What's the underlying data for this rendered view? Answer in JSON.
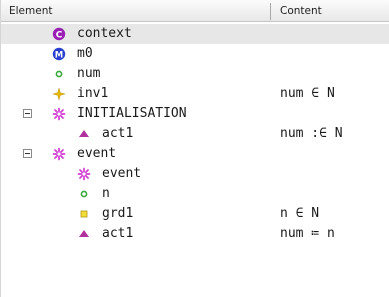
{
  "header": {
    "element_label": "Element",
    "content_label": "Content"
  },
  "rows": [
    {
      "label": "context",
      "content": ""
    },
    {
      "label": "m0",
      "content": ""
    },
    {
      "label": "num",
      "content": ""
    },
    {
      "label": "inv1",
      "content": "num ∈ N"
    },
    {
      "label": "INITIALISATION",
      "content": ""
    },
    {
      "label": "act1",
      "content": "num :∈ N"
    },
    {
      "label": "event",
      "content": ""
    },
    {
      "label": "event",
      "content": ""
    },
    {
      "label": "n",
      "content": ""
    },
    {
      "label": "grd1",
      "content": "n ∈ N"
    },
    {
      "label": "act1",
      "content": "num ≔ n"
    }
  ],
  "icons": [
    "context-icon",
    "machine-icon",
    "variable-icon",
    "invariant-icon",
    "event-icon",
    "action-icon",
    "event-icon",
    "event-icon",
    "parameter-icon",
    "guard-icon",
    "action-icon"
  ],
  "colors": {
    "context": "#9b1fb5",
    "machine": "#2a3fd0",
    "variable": "#3aa83a",
    "invariant": "#e8b800",
    "event": "#d23ad2",
    "action": "#b0309e",
    "guard": "#e0c400",
    "selected_row": "#e7e7e7"
  }
}
